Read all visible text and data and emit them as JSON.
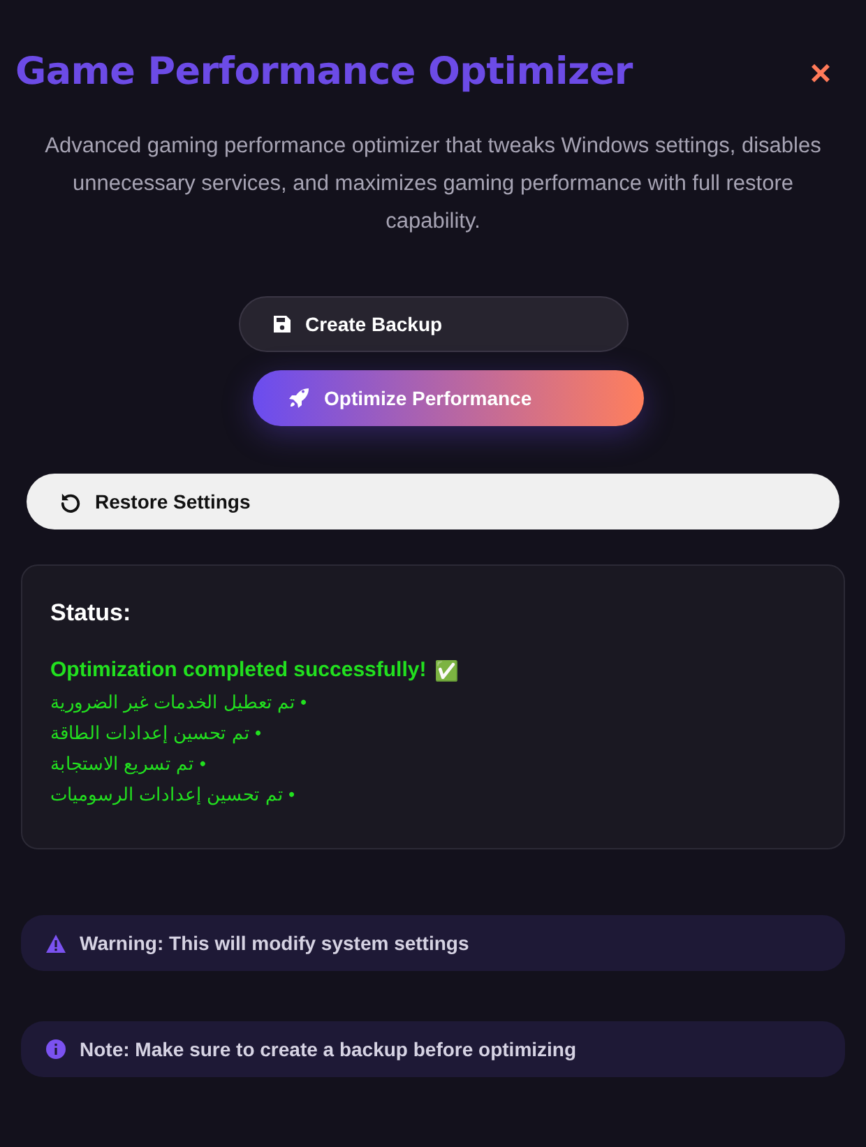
{
  "dialog": {
    "title": "Game Performance Optimizer",
    "close": "×",
    "description": "Advanced gaming performance optimizer that tweaks Windows settings, disables unnecessary services, and maximizes gaming performance with full restore capability."
  },
  "actions": [
    {
      "kind": "backup",
      "label": "Create Backup"
    },
    {
      "kind": "optimize",
      "label": "Optimize Performance"
    },
    {
      "kind": "restore",
      "label": "Restore Settings"
    }
  ],
  "status": {
    "heading": "Status:",
    "kind": "success",
    "message": "Optimization completed successfully!",
    "check": "✅",
    "lines": [
      "• تم تعطيل الخدمات غير الضرورية",
      "• تم تحسين إعدادات الطاقة",
      "• تم تسريع الاستجابة",
      "• تم تحسين إعدادات الرسوميات"
    ]
  },
  "notices": [
    {
      "kind": "warning",
      "text": "Warning: This will modify system settings"
    },
    {
      "kind": "info",
      "text": "Note: Make sure to create a backup before optimizing"
    }
  ]
}
